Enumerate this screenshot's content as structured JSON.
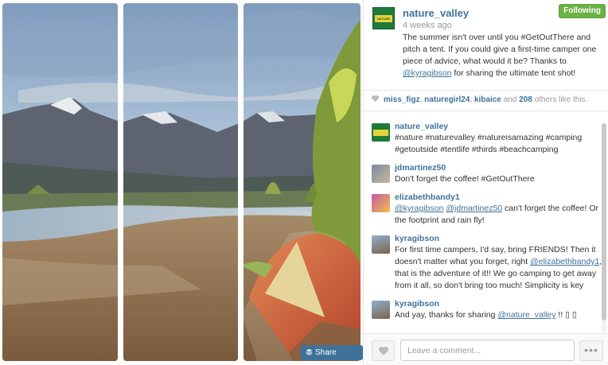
{
  "photo": {
    "share_label": "Share Image",
    "share_icon": "layers-icon"
  },
  "post": {
    "username": "nature_valley",
    "time_ago": "4 weeks ago",
    "follow_label": "Following",
    "caption_text": "The summer isn't over until you #GetOutThere and pitch a tent. If you could give a first-time camper one piece of advice, what would it be? Thanks to ",
    "caption_mention": "@kyragibson",
    "caption_tail": " for sharing the ultimate tent shot!",
    "avatar_label": "NATURE VALLEY"
  },
  "likes": {
    "user1": "miss_figz",
    "sep1": ", ",
    "user2": "naturegirl24",
    "sep2": ", ",
    "user3": "kibaice",
    "and": " and ",
    "count": "208",
    "suffix": " others like this."
  },
  "comments": [
    {
      "user": "nature_valley",
      "text": "#nature #naturevalley #natureisamazing #camping #getoutside #tentlife #thirds #beachcamping"
    },
    {
      "user": "jdmartinez50",
      "text": "Don't forget the coffee! #GetOutThere"
    },
    {
      "user": "elizabethbandy1",
      "m1": "@kyragibson",
      "m2": "@jdmartinez50",
      "text": " can't forget the coffee! Or the footprint and rain fly!"
    },
    {
      "user": "kyragibson",
      "t1": "For first time campers, I'd say, bring FRIENDS! Then it doesn't matter what you forget, right ",
      "m1": "@elizabethbandy1",
      "t2": ", that is the adventure of it!! We go camping to get away from it all, so don't bring too much! Simplicity is key"
    },
    {
      "user": "kyragibson",
      "t1": "And yay, thanks for sharing ",
      "m1": "@nature_valley",
      "t2": " !! ▯ ▯"
    }
  ],
  "footer": {
    "comment_placeholder": "Leave a comment...",
    "more_label": "•••"
  },
  "colors": {
    "link": "#3f729b",
    "follow_green": "#6bb344",
    "share_blue": "#3f729b"
  }
}
